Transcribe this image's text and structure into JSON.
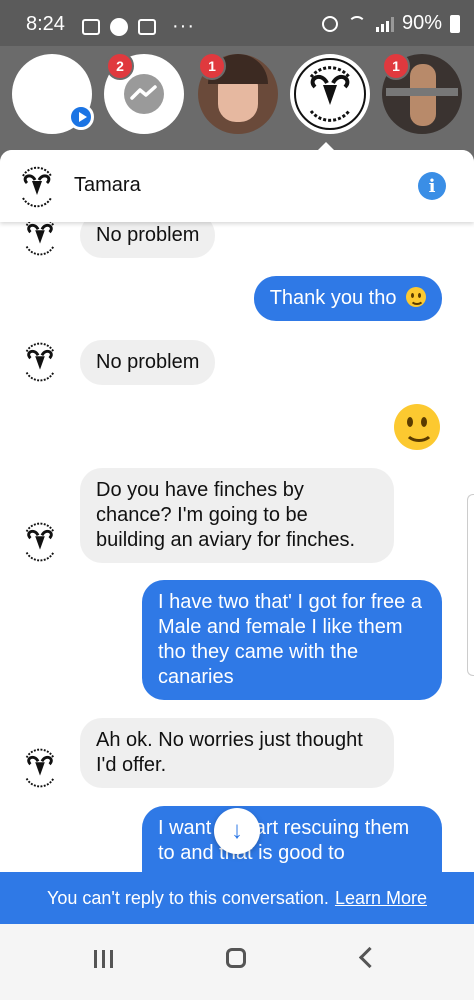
{
  "status": {
    "time": "8:24",
    "dots": "···",
    "battery": "90%"
  },
  "heads": [
    {
      "badge": ""
    },
    {
      "badge": "2"
    },
    {
      "badge": "1"
    },
    {
      "badge": ""
    },
    {
      "badge": "1"
    }
  ],
  "conversation": {
    "name": "Tamara",
    "info_icon": "i"
  },
  "messages": [
    {
      "text": "No problem"
    },
    {
      "text": "Thank you tho"
    },
    {
      "text": "No problem"
    },
    {
      "text": "Do you have finches by chance? I'm going to be building an aviary for finches."
    },
    {
      "text": "I have two that' I got for free a Male and female I like them tho they came with the canaries"
    },
    {
      "text": "Ah ok. No worries just thought I'd offer."
    },
    {
      "text": "I want to start rescuing them to and that is good to"
    }
  ],
  "banner": {
    "text": "You can't reply to this conversation.",
    "link": "Learn More"
  },
  "colors": {
    "accent": "#2f79e6",
    "badge": "#e0393e",
    "bubble_in": "#efefef"
  },
  "icons": [
    "gallery-icon",
    "messenger-icon",
    "alarm-icon",
    "wifi-icon",
    "signal-icon",
    "battery-icon",
    "info-icon",
    "scroll-down-icon",
    "recent-apps-icon",
    "home-icon",
    "back-icon"
  ]
}
